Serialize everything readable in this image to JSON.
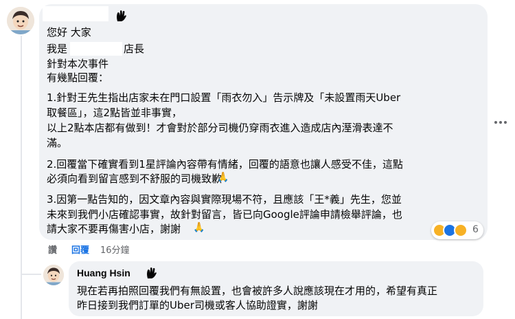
{
  "comment": {
    "badge_icon": "top-fan-icon",
    "lines": [
      "您好 大家",
      "我是",
      "針對本次事件",
      "有幾點回覆：",
      "1.針對王先生指出店家未在門口設置「雨衣勿入」告示牌及「未設置雨天Uber",
      "取餐區」，這2點皆並非事實，",
      "以上2點本店都有做到！才會對於部分司機仍穿雨衣進入造成店內溼滑表達不",
      "滿。",
      "2.回覆當下確實看到1星評論內容帶有情緒，回覆的語意也讓人感受不佳，這點",
      "必須向看到留言感到不舒服的司機致歉",
      "3.因第一點告知的，因文章內容與實際現場不符，且應該「王*義」先生，您並",
      "未來到我們小店確認事實，故針對留言，皆已向Google評論申請檢舉評論，也",
      "請大家不要再傷害小店，謝謝"
    ],
    "manager_suffix": "店長",
    "reactions": {
      "types": [
        "haha-reaction-icon",
        "like-reaction-icon",
        "sad-reaction-icon"
      ],
      "count": "6"
    },
    "actions": {
      "like": "讚",
      "reply": "回覆",
      "time": "16分鐘"
    },
    "more_options_icon": "more-horizontal-icon"
  },
  "reply": {
    "author": "Huang Hsin",
    "badge_icon": "top-fan-icon",
    "lines": [
      "現在若再拍照回覆我們有無設置，也會被許多人說應該現在才用的，希望有真正",
      "昨日接到我們訂單的Uber司機或客人協助證實，謝謝"
    ]
  },
  "colors": {
    "bubble": "#f0f2f5",
    "text": "#050505",
    "secondary": "#65676b",
    "link": "#1b74e4",
    "pray_emoji": "#f5a623"
  }
}
